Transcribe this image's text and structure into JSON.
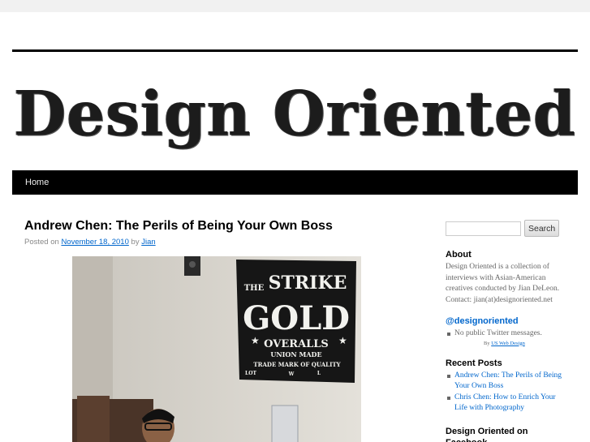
{
  "site": {
    "title": "Design Oriented"
  },
  "nav": {
    "items": [
      {
        "label": "Home"
      }
    ]
  },
  "post": {
    "title": "Andrew Chen: The Perils of Being Your Own Boss",
    "meta_prefix": "Posted on",
    "date": "November 18, 2010",
    "by": "by",
    "author": "Jian",
    "image": {
      "flag_lines": [
        "THE",
        "STRIKE",
        "GOLD",
        "OVERALLS",
        "UNION MADE",
        "TRADE MARK OF QUALITY",
        "LOT",
        "W",
        "L"
      ]
    }
  },
  "sidebar": {
    "search": {
      "placeholder": "",
      "button_label": "Search"
    },
    "about": {
      "title": "About",
      "text": "Design Oriented is a collection of interviews with Asian-American creatives conducted by Jian DeLeon. Contact: jian(at)designoriented.net"
    },
    "twitter": {
      "title": "@designoriented",
      "items": [
        "No public Twitter messages."
      ],
      "credit_prefix": "By",
      "credit_link": "US Web Design"
    },
    "recent": {
      "title": "Recent Posts",
      "items": [
        "Andrew Chen: The Perils of Being Your Own Boss",
        "Chris Chen: How to Enrich Your Life with Photography"
      ]
    },
    "facebook": {
      "title": "Design Oriented on Facebook"
    }
  },
  "colors": {
    "link": "#0066cc",
    "nav_bg": "#000000",
    "page_bg": "#ffffff",
    "outer_bg": "#f1f1f1"
  }
}
